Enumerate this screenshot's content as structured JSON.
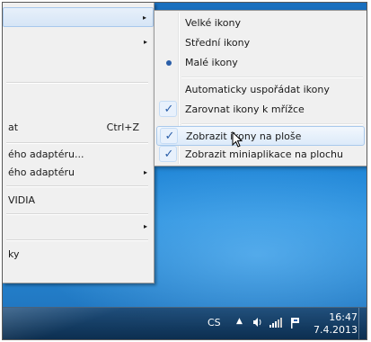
{
  "main_menu": {
    "items": [
      {
        "label": "",
        "shortcut": "",
        "arrow": "▸"
      },
      {
        "label": "",
        "shortcut": "",
        "arrow": "▸"
      },
      {
        "label": "",
        "shortcut": "",
        "arrow": ""
      },
      {
        "label": "",
        "shortcut": "",
        "arrow": ""
      },
      {
        "label": "at",
        "shortcut": "Ctrl+Z",
        "arrow": ""
      },
      {
        "label": "ého adaptéru...",
        "shortcut": "",
        "arrow": ""
      },
      {
        "label": "ého adaptéru",
        "shortcut": "",
        "arrow": "▸"
      },
      {
        "label": "VIDIA",
        "shortcut": "",
        "arrow": ""
      },
      {
        "label": "",
        "shortcut": "",
        "arrow": "▸"
      },
      {
        "label": "ky",
        "shortcut": "",
        "arrow": ""
      }
    ]
  },
  "view_submenu": {
    "items": [
      {
        "label": "Velké ikony",
        "state": "none"
      },
      {
        "label": "Střední ikony",
        "state": "none"
      },
      {
        "label": "Malé ikony",
        "state": "radio"
      },
      {
        "label": "Automaticky uspořádat ikony",
        "state": "none"
      },
      {
        "label": "Zarovnat ikony k mřížce",
        "state": "check"
      },
      {
        "label": "Zobrazit ikony na ploše",
        "state": "check"
      },
      {
        "label": "Zobrazit miniaplikace na plochu",
        "state": "check"
      }
    ],
    "check_glyph": "✓"
  },
  "taskbar": {
    "language": "CS",
    "time": "16:47",
    "date": "7.4.2013"
  },
  "icons": [
    "submenu-arrow-icon",
    "checkmark-icon",
    "radio-dot-icon",
    "mouse-pointer-icon",
    "speaker-icon",
    "network-signal-icon",
    "action-center-flag-icon",
    "show-hidden-icons-icon"
  ],
  "colors": {
    "menu_bg": "#f0f0f0",
    "highlight": "#dceaf9",
    "check": "#2a5ea8",
    "desktop": "#1f84d6"
  }
}
